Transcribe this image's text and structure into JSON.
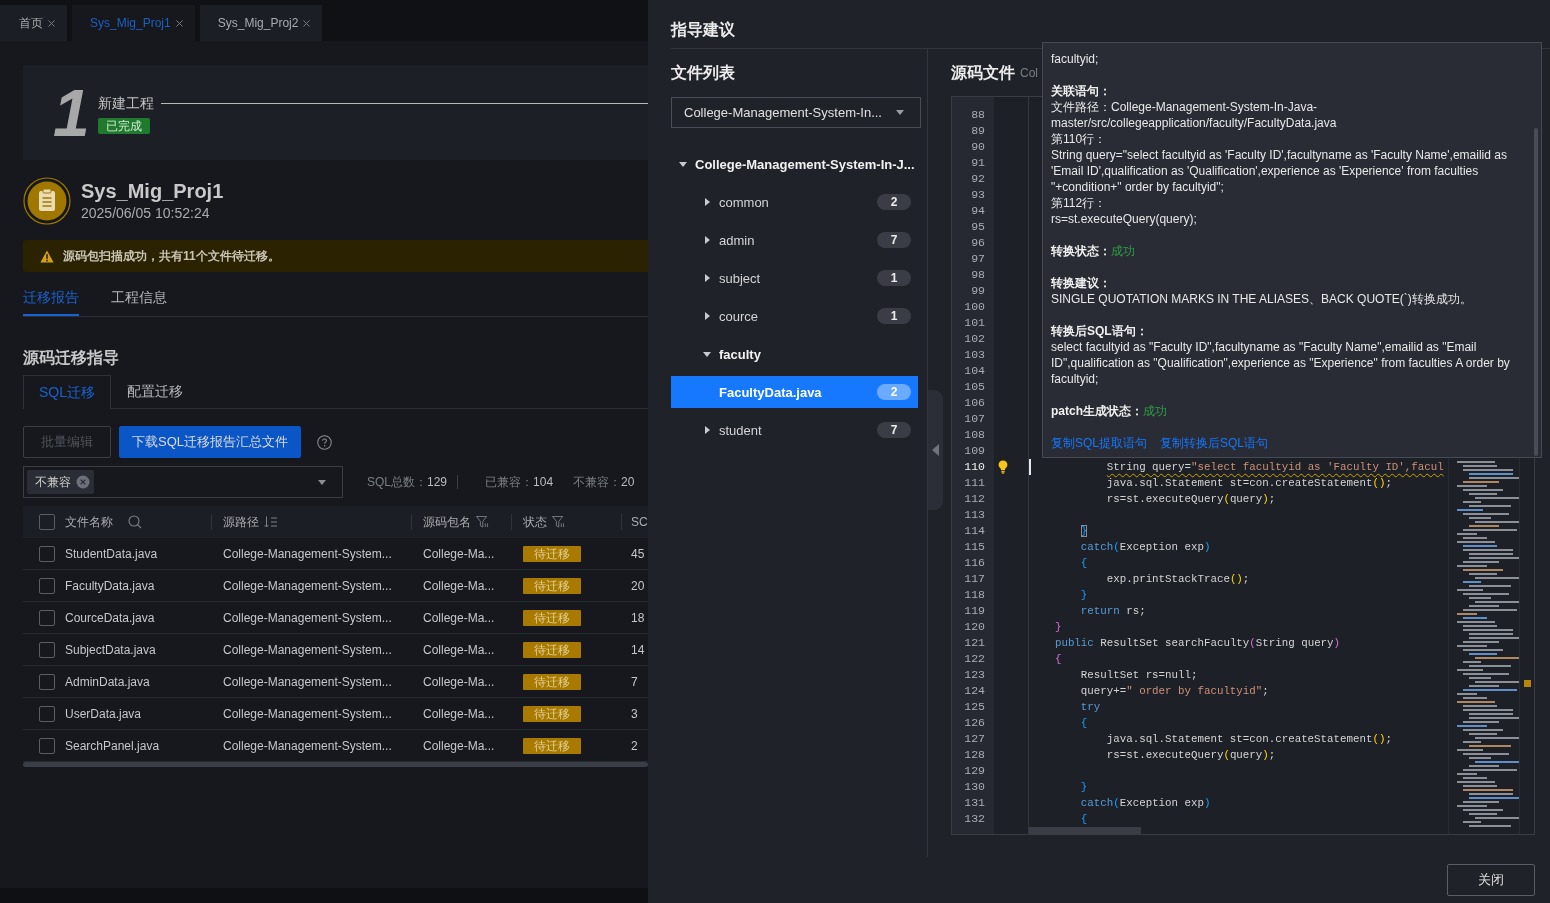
{
  "tabs": [
    {
      "label": "首页",
      "selected": false
    },
    {
      "label": "Sys_Mig_Proj1",
      "selected": true
    },
    {
      "label": "Sys_Mig_Proj2",
      "selected": false
    }
  ],
  "step": {
    "number": "1",
    "title": "新建工程",
    "status": "已完成"
  },
  "project": {
    "name": "Sys_Mig_Proj1",
    "time": "2025/06/05 10:52:24"
  },
  "alert": {
    "message": "源码包扫描成功，共有11个文件待迁移。"
  },
  "report_tabs": [
    {
      "label": "迁移报告",
      "selected": true
    },
    {
      "label": "工程信息",
      "selected": false
    }
  ],
  "section_title": "源码迁移指导",
  "migration_tabs": [
    {
      "label": "SQL迁移",
      "selected": true
    },
    {
      "label": "配置迁移",
      "selected": false
    }
  ],
  "actions": [
    {
      "label": "批量编辑",
      "kind": "default",
      "disabled": true
    },
    {
      "label": "下载SQL迁移报告汇总文件",
      "kind": "primary",
      "disabled": false
    }
  ],
  "filter": {
    "tags": [
      "不兼容"
    ]
  },
  "stats": [
    {
      "label": "SQL总数：",
      "value": "129"
    },
    {
      "label": "已兼容：",
      "value": "104"
    },
    {
      "label": "不兼容：",
      "value": "20"
    }
  ],
  "table": {
    "all_checked": false,
    "columns": [
      {
        "label": "文件名称",
        "kind": "search"
      },
      {
        "label": "源路径",
        "kind": "sort"
      },
      {
        "label": "源码包名",
        "kind": "filter"
      },
      {
        "label": "状态",
        "kind": "filter"
      },
      {
        "label": "SC",
        "kind": "plain"
      }
    ],
    "rows": [
      {
        "checked": false,
        "file_name": "StudentData.java",
        "source_path": "College-Management-System...",
        "package_name": "College-Ma...",
        "status": "待迁移",
        "column_5": "45"
      },
      {
        "checked": false,
        "file_name": "FacultyData.java",
        "source_path": "College-Management-System...",
        "package_name": "College-Ma...",
        "status": "待迁移",
        "column_5": "20"
      },
      {
        "checked": false,
        "file_name": "CourceData.java",
        "source_path": "College-Management-System...",
        "package_name": "College-Ma...",
        "status": "待迁移",
        "column_5": "18"
      },
      {
        "checked": false,
        "file_name": "SubjectData.java",
        "source_path": "College-Management-System...",
        "package_name": "College-Ma...",
        "status": "待迁移",
        "column_5": "14"
      },
      {
        "checked": false,
        "file_name": "AdminData.java",
        "source_path": "College-Management-System...",
        "package_name": "College-Ma...",
        "status": "待迁移",
        "column_5": "7"
      },
      {
        "checked": false,
        "file_name": "UserData.java",
        "source_path": "College-Management-System...",
        "package_name": "College-Ma...",
        "status": "待迁移",
        "column_5": "3"
      },
      {
        "checked": false,
        "file_name": "SearchPanel.java",
        "source_path": "College-Management-System...",
        "package_name": "College-Ma...",
        "status": "待迁移",
        "column_5": "2"
      }
    ]
  },
  "drawer": {
    "title": "指导建议",
    "file_list": {
      "title": "文件列表",
      "project_select": "College-Management-System-In...",
      "tree": [
        {
          "label": "College-Management-System-In-J...",
          "kind": "folder",
          "expanded": true,
          "selected": false,
          "children": [
            {
              "label": "common",
              "kind": "folder",
              "expanded": false,
              "selected": false,
              "count": "2"
            },
            {
              "label": "admin",
              "kind": "folder",
              "expanded": false,
              "selected": false,
              "count": "7"
            },
            {
              "label": "subject",
              "kind": "folder",
              "expanded": false,
              "selected": false,
              "count": "1"
            },
            {
              "label": "cource",
              "kind": "folder",
              "expanded": false,
              "selected": false,
              "count": "1"
            },
            {
              "label": "faculty",
              "kind": "folder",
              "expanded": true,
              "selected": false,
              "children": [
                {
                  "label": "FacultyData.java",
                  "kind": "file",
                  "selected": true,
                  "count": "2"
                }
              ]
            },
            {
              "label": "student",
              "kind": "folder",
              "expanded": false,
              "selected": false,
              "count": "7"
            }
          ]
        }
      ]
    },
    "source": {
      "title": "源码文件",
      "path": "Col",
      "lines": [
        {
          "number": "88",
          "warning": false,
          "current": false
        },
        {
          "number": "89",
          "warning": false,
          "current": false
        },
        {
          "number": "90",
          "warning": false,
          "current": false
        },
        {
          "number": "91",
          "warning": false,
          "current": false
        },
        {
          "number": "92",
          "warning": false,
          "current": false
        },
        {
          "number": "93",
          "warning": false,
          "current": false
        },
        {
          "number": "94",
          "warning": false,
          "current": false
        },
        {
          "number": "95",
          "warning": false,
          "current": false
        },
        {
          "number": "96",
          "warning": false,
          "current": false
        },
        {
          "number": "97",
          "warning": false,
          "current": false
        },
        {
          "number": "98",
          "warning": false,
          "current": false
        },
        {
          "number": "99",
          "warning": false,
          "current": false
        },
        {
          "number": "100",
          "warning": false,
          "current": false
        },
        {
          "number": "101",
          "warning": false,
          "current": false
        },
        {
          "number": "102",
          "warning": false,
          "current": false
        },
        {
          "number": "103",
          "warning": false,
          "current": false
        },
        {
          "number": "104",
          "warning": false,
          "current": false
        },
        {
          "number": "105",
          "warning": false,
          "current": false
        },
        {
          "number": "106",
          "warning": false,
          "current": false
        },
        {
          "number": "107",
          "warning": false,
          "current": false
        },
        {
          "number": "108",
          "warning": false,
          "current": false
        },
        {
          "number": "109",
          "warning": false,
          "current": false
        },
        {
          "number": "110",
          "warning": true,
          "current": true,
          "tokens": [
            {
              "kind": "plain",
              "text": "            String query="
            },
            {
              "kind": "string",
              "text": "\"select facultyid as 'Faculty ID',facul"
            }
          ]
        },
        {
          "number": "111",
          "warning": false,
          "current": false,
          "tokens": [
            {
              "kind": "plain",
              "text": "            java.sql.Statement st=con.createStatement"
            },
            {
              "kind": "bracket-gold",
              "text": "()"
            },
            {
              "kind": "plain",
              "text": ";"
            }
          ]
        },
        {
          "number": "112",
          "warning": false,
          "current": false,
          "tokens": [
            {
              "kind": "plain",
              "text": "            rs=st.executeQuery"
            },
            {
              "kind": "bracket-gold",
              "text": "("
            },
            {
              "kind": "plain",
              "text": "query"
            },
            {
              "kind": "bracket-gold",
              "text": ")"
            },
            {
              "kind": "plain",
              "text": ";"
            }
          ]
        },
        {
          "number": "113",
          "warning": false,
          "current": false
        },
        {
          "number": "114",
          "warning": false,
          "current": false,
          "tokens": [
            {
              "kind": "bracket-match",
              "text": "        }"
            }
          ]
        },
        {
          "number": "115",
          "warning": false,
          "current": false,
          "tokens": [
            {
              "kind": "keyword",
              "text": "        catch"
            },
            {
              "kind": "bracket-blue",
              "text": "("
            },
            {
              "kind": "plain",
              "text": "Exception exp"
            },
            {
              "kind": "bracket-blue",
              "text": ")"
            }
          ]
        },
        {
          "number": "116",
          "warning": false,
          "current": false,
          "tokens": [
            {
              "kind": "bracket-blue",
              "text": "        {"
            }
          ]
        },
        {
          "number": "117",
          "warning": false,
          "current": false,
          "tokens": [
            {
              "kind": "plain",
              "text": "            exp.printStackTrace"
            },
            {
              "kind": "bracket-gold",
              "text": "()"
            },
            {
              "kind": "plain",
              "text": ";"
            }
          ]
        },
        {
          "number": "118",
          "warning": false,
          "current": false,
          "tokens": [
            {
              "kind": "bracket-blue",
              "text": "        }"
            }
          ]
        },
        {
          "number": "119",
          "warning": false,
          "current": false,
          "tokens": [
            {
              "kind": "keyword",
              "text": "        return"
            },
            {
              "kind": "plain",
              "text": " rs;"
            }
          ]
        },
        {
          "number": "120",
          "warning": false,
          "current": false,
          "tokens": [
            {
              "kind": "bracket-pink",
              "text": "    }"
            }
          ]
        },
        {
          "number": "121",
          "warning": false,
          "current": false,
          "tokens": [
            {
              "kind": "keyword",
              "text": "    public"
            },
            {
              "kind": "plain",
              "text": " ResultSet searchFaculty"
            },
            {
              "kind": "bracket-pink",
              "text": "("
            },
            {
              "kind": "plain",
              "text": "String query"
            },
            {
              "kind": "bracket-pink",
              "text": ")"
            }
          ]
        },
        {
          "number": "122",
          "warning": false,
          "current": false,
          "tokens": [
            {
              "kind": "bracket-pink",
              "text": "    {"
            }
          ]
        },
        {
          "number": "123",
          "warning": false,
          "current": false,
          "tokens": [
            {
              "kind": "plain",
              "text": "        ResultSet rs=null;"
            }
          ]
        },
        {
          "number": "124",
          "warning": false,
          "current": false,
          "tokens": [
            {
              "kind": "plain",
              "text": "        query+="
            },
            {
              "kind": "string",
              "text": "\" order by facultyid\""
            },
            {
              "kind": "plain",
              "text": ";"
            }
          ]
        },
        {
          "number": "125",
          "warning": false,
          "current": false,
          "tokens": [
            {
              "kind": "keyword",
              "text": "        try"
            }
          ]
        },
        {
          "number": "126",
          "warning": false,
          "current": false,
          "tokens": [
            {
              "kind": "bracket-blue",
              "text": "        {"
            }
          ]
        },
        {
          "number": "127",
          "warning": false,
          "current": false,
          "tokens": [
            {
              "kind": "plain",
              "text": "            java.sql.Statement st=con.createStatement"
            },
            {
              "kind": "bracket-gold",
              "text": "()"
            },
            {
              "kind": "plain",
              "text": ";"
            }
          ]
        },
        {
          "number": "128",
          "warning": false,
          "current": false,
          "tokens": [
            {
              "kind": "plain",
              "text": "            rs=st.executeQuery"
            },
            {
              "kind": "bracket-gold",
              "text": "("
            },
            {
              "kind": "plain",
              "text": "query"
            },
            {
              "kind": "bracket-gold",
              "text": ")"
            },
            {
              "kind": "plain",
              "text": ";"
            }
          ]
        },
        {
          "number": "129",
          "warning": false,
          "current": false
        },
        {
          "number": "130",
          "warning": false,
          "current": false,
          "tokens": [
            {
              "kind": "bracket-blue",
              "text": "        }"
            }
          ]
        },
        {
          "number": "131",
          "warning": false,
          "current": false,
          "tokens": [
            {
              "kind": "keyword",
              "text": "        catch"
            },
            {
              "kind": "bracket-blue",
              "text": "("
            },
            {
              "kind": "plain",
              "text": "Exception exp"
            },
            {
              "kind": "bracket-blue",
              "text": ")"
            }
          ]
        },
        {
          "number": "132",
          "warning": false,
          "current": false,
          "tokens": [
            {
              "kind": "bracket-blue",
              "text": "        {"
            }
          ]
        }
      ]
    },
    "close_button": "关闭"
  },
  "detail_popup": {
    "sections": [
      {
        "kind": "text",
        "lines": [
          "facultyid;"
        ]
      },
      {
        "kind": "block",
        "heading": "关联语句：",
        "lines": [
          "文件路径：College-Management-System-In-Java-master/src/collegeapplication/faculty/FacultyData.java",
          "第110行：",
          "String query=\"select facultyid as 'Faculty ID',facultyname as 'Faculty Name',emailid as 'Email ID',qualification as 'Qualification',experience as 'Experience' from faculties  \"+condition+\" order by facultyid\";",
          "第112行：",
          "rs=st.executeQuery(query);"
        ]
      },
      {
        "kind": "status",
        "heading": "转换状态：",
        "value": "成功"
      },
      {
        "kind": "block",
        "heading": "转换建议：",
        "lines": [
          "SINGLE QUOTATION MARKS IN THE ALIASES、BACK QUOTE(`)转换成功。"
        ]
      },
      {
        "kind": "block",
        "heading": "转换后SQL语句：",
        "lines": [
          "select facultyid as \"Faculty ID\",facultyname as \"Faculty Name\",emailid as \"Email ID\",qualification as \"Qualification\",experience as \"Experience\" from faculties A order by facultyid;"
        ]
      },
      {
        "kind": "status",
        "heading": "patch生成状态：",
        "value": "成功"
      }
    ],
    "links": [
      "复制SQL提取语句",
      "复制转换后SQL语句"
    ]
  }
}
